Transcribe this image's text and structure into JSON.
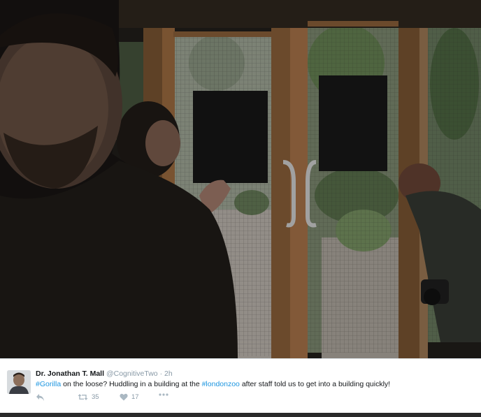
{
  "photo": {
    "alt": "selfie inside building"
  },
  "tweet": {
    "author": "Dr. Jonathan T. Mall",
    "handle": "@CognitiveTwo",
    "separator": "·",
    "time": "2h",
    "text": {
      "hashtag1": "#Gorilla",
      "part1": " on the loose? Huddling in a building at the ",
      "hashtag2": "#londonzoo",
      "part2": " after staff told us to get into a building quickly!"
    },
    "actions": {
      "reply_icon": "reply-icon",
      "retweet_icon": "retweet-icon",
      "retweet_count": "35",
      "like_icon": "heart-icon",
      "like_count": "17",
      "more_icon": "more-icon"
    }
  },
  "colors": {
    "link": "#1b95e0",
    "text": "#14171a",
    "muted": "#8899a6",
    "icon": "#aab8c2"
  }
}
